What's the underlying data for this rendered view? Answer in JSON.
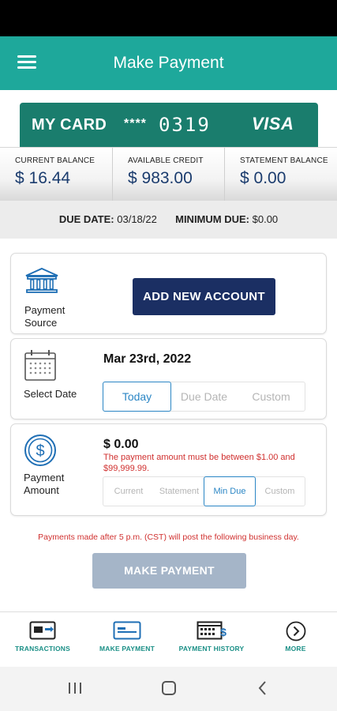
{
  "app_bar": {
    "title": "Make Payment",
    "menu_icon": "hamburger-menu-icon"
  },
  "card": {
    "name": "MY CARD",
    "mask": "****",
    "last4": "0319",
    "brand": "VISA",
    "color": "#1a7d6d"
  },
  "balances": [
    {
      "label": "CURRENT BALANCE",
      "value": "$ 16.44"
    },
    {
      "label": "AVAILABLE CREDIT",
      "value": "$ 983.00"
    },
    {
      "label": "STATEMENT BALANCE",
      "value": "$ 0.00"
    }
  ],
  "due": {
    "date_label": "DUE DATE:",
    "date_value": "03/18/22",
    "min_label": "MINIMUM DUE:",
    "min_value": "$0.00"
  },
  "payment_source": {
    "label": "Payment Source",
    "icon": "bank-icon",
    "button": "ADD NEW ACCOUNT"
  },
  "select_date": {
    "label": "Select Date",
    "icon": "calendar-icon",
    "value": "Mar 23rd, 2022",
    "options": [
      "Today",
      "Due Date",
      "Custom"
    ],
    "selected": "Today"
  },
  "payment_amount": {
    "label": "Payment Amount",
    "icon": "dollar-circle-icon",
    "value": "$  0.00",
    "error": "The payment amount must be between $1.00 and $99,999.99.",
    "options": [
      "Current",
      "Statement",
      "Min Due",
      "Custom"
    ],
    "selected": "Min Due"
  },
  "notice": "Payments made after 5 p.m. (CST) will post the following business day.",
  "make_payment_button": "MAKE PAYMENT",
  "bottom_nav": [
    {
      "label": "TRANSACTIONS",
      "icon": "transactions-card-icon"
    },
    {
      "label": "MAKE PAYMENT",
      "icon": "make-payment-card-icon"
    },
    {
      "label": "PAYMENT HISTORY",
      "icon": "payment-history-icon"
    },
    {
      "label": "MORE",
      "icon": "chevron-right-circle-icon"
    }
  ],
  "colors": {
    "accent": "#1ea89b",
    "primary_button": "#1b2f63",
    "disabled_button": "#a5b5c8",
    "error": "#d0302f",
    "selected": "#2b86c5"
  }
}
